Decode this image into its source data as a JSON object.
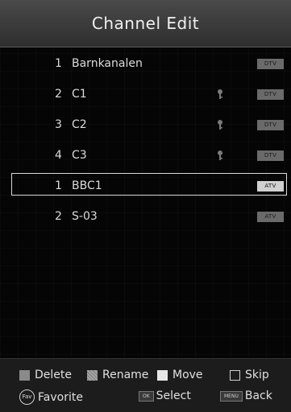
{
  "header": {
    "title": "Channel Edit"
  },
  "channels": [
    {
      "number": "1",
      "name": "Barnkanalen",
      "locked": false,
      "type": "DTV",
      "selected": false
    },
    {
      "number": "2",
      "name": "C1",
      "locked": true,
      "type": "DTV",
      "selected": false
    },
    {
      "number": "3",
      "name": "C2",
      "locked": true,
      "type": "DTV",
      "selected": false
    },
    {
      "number": "4",
      "name": "C3",
      "locked": true,
      "type": "DTV",
      "selected": false
    },
    {
      "number": "1",
      "name": "BBC1",
      "locked": false,
      "type": "ATV",
      "selected": true
    },
    {
      "number": "2",
      "name": "S-03",
      "locked": false,
      "type": "ATV",
      "selected": false
    }
  ],
  "footer": {
    "delete_label": "Delete",
    "rename_label": "Rename",
    "move_label": "Move",
    "skip_label": "Skip",
    "fav_key": "Fav",
    "favorite_label": "Favorite",
    "ok_key": "OK",
    "select_label": "Select",
    "menu_key": "MENU",
    "back_label": "Back"
  },
  "colors": {
    "header_bg": "#3a3a3a",
    "delete_color": "#8a8a8a",
    "move_color": "#e6e6e6"
  }
}
